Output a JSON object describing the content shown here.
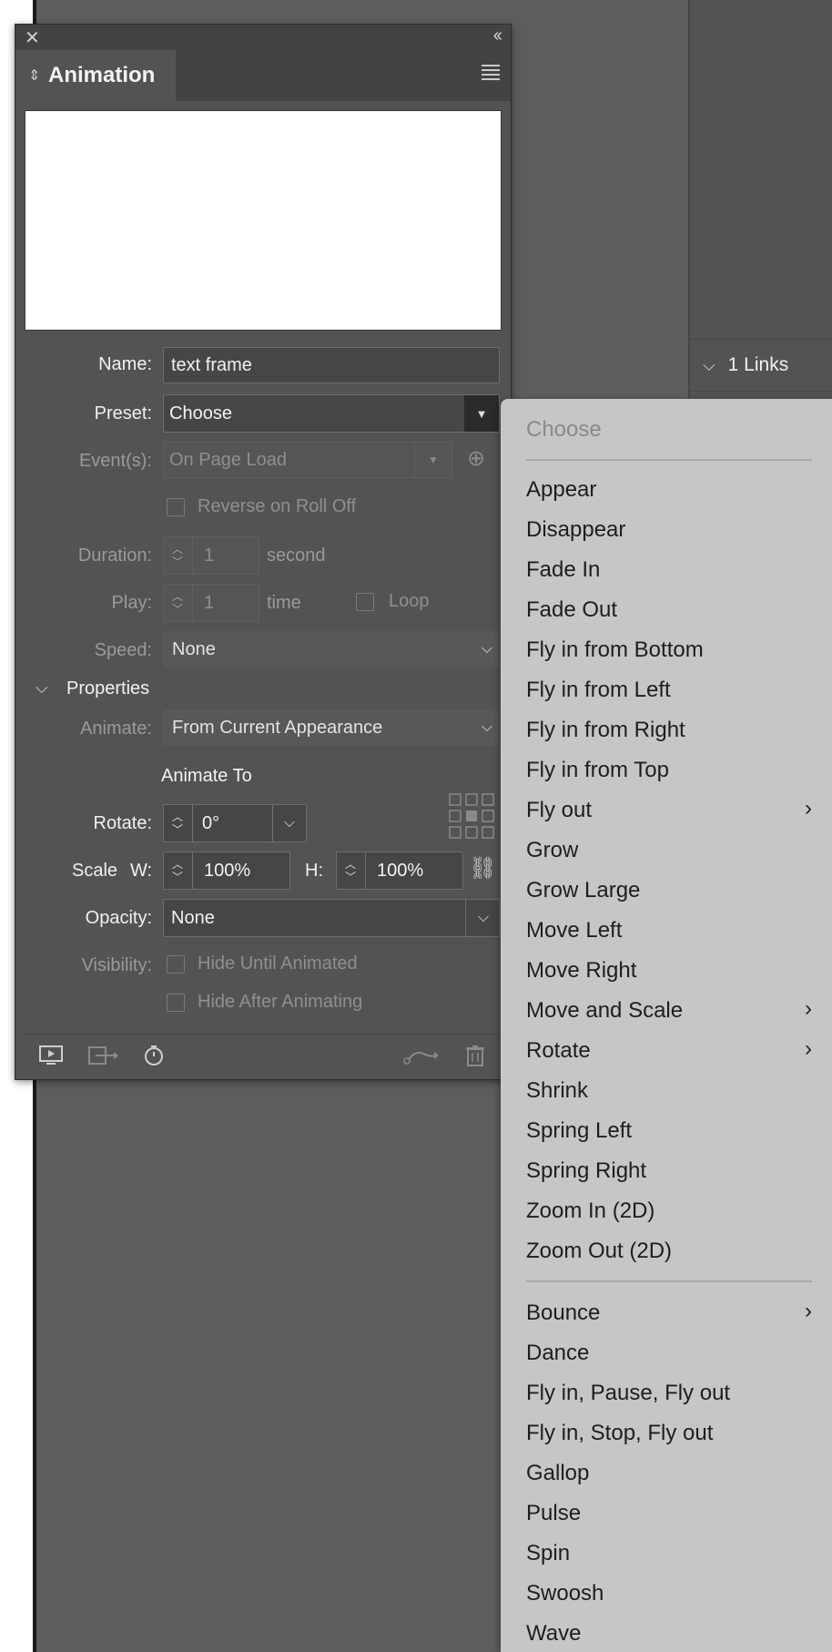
{
  "panel": {
    "title": "Animation",
    "close_glyph": "✕",
    "collapse_glyph": "‹‹",
    "name_label": "Name:",
    "name_value": "text frame",
    "preset_label": "Preset:",
    "preset_value": "Choose",
    "events_label": "Event(s):",
    "events_value": "On Page Load",
    "reverse_label": "Reverse on Roll Off",
    "duration_label": "Duration:",
    "duration_value": "1",
    "duration_unit": "second",
    "play_label": "Play:",
    "play_value": "1",
    "play_unit": "time",
    "loop_label": "Loop",
    "speed_label": "Speed:",
    "speed_value": "None",
    "properties_label": "Properties",
    "animate_label": "Animate:",
    "animate_value": "From Current Appearance",
    "animate_to_label": "Animate To",
    "rotate_label": "Rotate:",
    "rotate_value": "0°",
    "scale_label": "Scale",
    "w_label": "W:",
    "w_value": "100%",
    "h_label": "H:",
    "h_value": "100%",
    "opacity_label": "Opacity:",
    "opacity_value": "None",
    "visibility_label": "Visibility:",
    "hide_until_label": "Hide Until Animated",
    "hide_after_label": "Hide After Animating"
  },
  "links_panel": {
    "label": "1 Links"
  },
  "menu": {
    "header": "Choose",
    "group1": [
      "Appear",
      "Disappear",
      "Fade In",
      "Fade Out",
      "Fly in from Bottom",
      "Fly in from Left",
      "Fly in from Right",
      "Fly in from Top",
      "Fly out",
      "Grow",
      "Grow Large",
      "Move Left",
      "Move Right",
      "Move and Scale",
      "Rotate",
      "Shrink",
      "Spring Left",
      "Spring Right",
      "Zoom In (2D)",
      "Zoom Out (2D)"
    ],
    "group2": [
      "Bounce",
      "Dance",
      "Fly in, Pause, Fly out",
      "Fly in, Stop, Fly out",
      "Gallop",
      "Pulse",
      "Spin",
      "Swoosh",
      "Wave"
    ],
    "submenu_items": [
      "Fly out",
      "Move and Scale",
      "Rotate",
      "Bounce"
    ]
  },
  "icons": [
    "close-icon",
    "collapse-icon",
    "sort-icon",
    "panel-menu-icon",
    "dropdown-arrow-icon",
    "event-add-icon",
    "stepper-icon",
    "chevron-down-icon",
    "proxy-grid-icon",
    "link-icon",
    "preview-icon",
    "spread-preview-icon",
    "timing-icon",
    "motion-path-icon",
    "trash-icon",
    "submenu-arrow-icon"
  ]
}
